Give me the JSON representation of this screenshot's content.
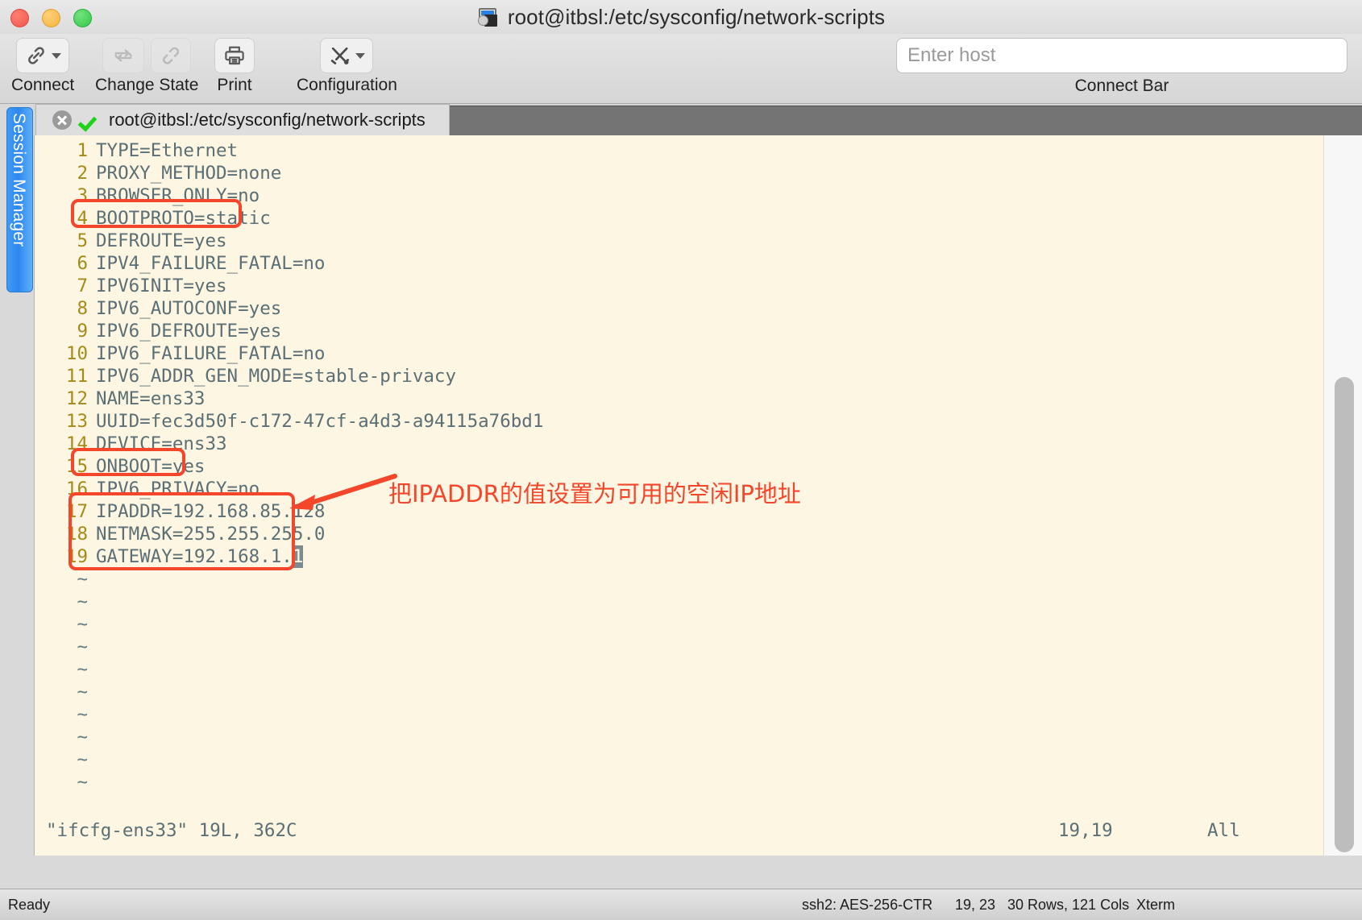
{
  "window": {
    "title": "root@itbsl:/etc/sysconfig/network-scripts",
    "title_icon": "terminal-lock-icon",
    "traffic_lights": [
      "close",
      "minimize",
      "maximize"
    ]
  },
  "toolbar": {
    "buttons": [
      {
        "label": "Connect",
        "icon": "link-icon",
        "has_dropdown": true,
        "disabled": false
      },
      {
        "label": "Change State",
        "icons": [
          "loop-arrows-icon",
          "broken-link-icon"
        ],
        "disabled": true
      },
      {
        "label": "Print",
        "icon": "printer-icon",
        "has_dropdown": false,
        "disabled": false
      },
      {
        "label": "Configuration",
        "icon": "tools-icon",
        "has_dropdown": true,
        "disabled": false
      }
    ],
    "connect_bar": {
      "placeholder": "Enter host",
      "value": "",
      "label": "Connect Bar"
    }
  },
  "sidebar": {
    "session_manager_label": "Session Manager"
  },
  "tabs": [
    {
      "title": "root@itbsl:/etc/sysconfig/network-scripts",
      "close_icon": "close-circle-icon",
      "status_icon": "green-check-icon",
      "active": true
    }
  ],
  "terminal": {
    "file_lines": [
      {
        "n": "1",
        "text": "TYPE=Ethernet"
      },
      {
        "n": "2",
        "text": "PROXY_METHOD=none"
      },
      {
        "n": "3",
        "text": "BROWSER_ONLY=no"
      },
      {
        "n": "4",
        "text": "BOOTPROTO=static"
      },
      {
        "n": "5",
        "text": "DEFROUTE=yes"
      },
      {
        "n": "6",
        "text": "IPV4_FAILURE_FATAL=no"
      },
      {
        "n": "7",
        "text": "IPV6INIT=yes"
      },
      {
        "n": "8",
        "text": "IPV6_AUTOCONF=yes"
      },
      {
        "n": "9",
        "text": "IPV6_DEFROUTE=yes"
      },
      {
        "n": "10",
        "text": "IPV6_FAILURE_FATAL=no"
      },
      {
        "n": "11",
        "text": "IPV6_ADDR_GEN_MODE=stable-privacy"
      },
      {
        "n": "12",
        "text": "NAME=ens33"
      },
      {
        "n": "13",
        "text": "UUID=fec3d50f-c172-47cf-a4d3-a94115a76bd1"
      },
      {
        "n": "14",
        "text": "DEVICE=ens33"
      },
      {
        "n": "15",
        "text": "ONBOOT=yes"
      },
      {
        "n": "16",
        "text": "IPV6_PRIVACY=no"
      },
      {
        "n": "17",
        "text": "IPADDR=192.168.85.128"
      },
      {
        "n": "18",
        "text": "NETMASK=255.255.255.0"
      },
      {
        "n": "19",
        "text_before_cursor": "GATEWAY=192.168.1.",
        "cursor_char": "1"
      }
    ],
    "empty_marker": "~",
    "empty_marker_count": 10,
    "vim_status": {
      "file_info": "\"ifcfg-ens33\" 19L, 362C",
      "cursor_position": "19,19",
      "scroll_position": "All"
    }
  },
  "annotations": {
    "boxes": [
      {
        "name": "bootproto-highlight",
        "target_line": "4"
      },
      {
        "name": "onboot-highlight",
        "target_line": "15"
      },
      {
        "name": "ip-settings-highlight",
        "target_lines": "17-19"
      }
    ],
    "arrow": {
      "name": "callout-arrow",
      "direction": "right-to-left"
    },
    "text": "把IPADDR的值设置为可用的空闲IP地址",
    "color": "#f4462a"
  },
  "statusbar": {
    "ready": "Ready",
    "ssh": "ssh2: AES-256-CTR",
    "position": "19, 23",
    "dimensions": "30 Rows, 121 Cols",
    "emulation": "Xterm"
  }
}
